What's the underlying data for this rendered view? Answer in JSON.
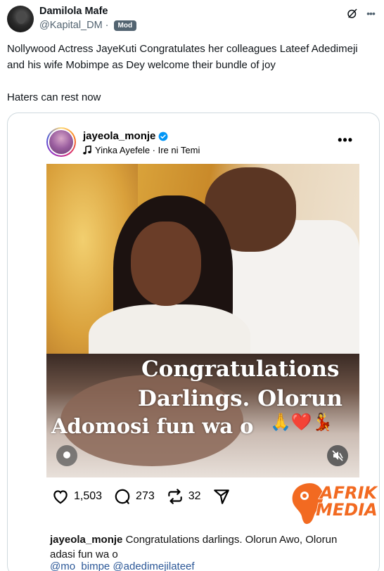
{
  "author": {
    "name": "Damilola Mafe",
    "handle": "@Kapital_DM",
    "separator": "·",
    "badge": "Mod"
  },
  "icons": {
    "grok": "grok-icon",
    "more": "more-icon"
  },
  "tweet": {
    "line1": "Nollywood Actress JayeKuti Congratulates her colleagues Lateef Adedimeji and his wife Mobimpe as Dey welcome their bundle of joy",
    "line2": "Haters can rest now"
  },
  "instagram": {
    "username": "jayeola_monje",
    "song": "Yinka Ayefele · Ire ni Temi",
    "more": "•••",
    "overlay": {
      "line1": "Congratulations",
      "line2": "Darlings. Olorun",
      "line3": "Adomosi fun wa o",
      "emojis": "🙏❤️💃"
    },
    "actions": {
      "likes": "1,503",
      "comments": "273",
      "reposts": "32"
    },
    "caption": {
      "user": "jayeola_monje",
      "text": "Congratulations darlings. Olorun Awo, Olorun adasi fun wa o"
    },
    "mentions": "@mo_bimpe @adedimejilateef"
  },
  "watermark": {
    "line1": "AFRIK",
    "line2": "MEDIA",
    "colors": {
      "orange": "#f26a21"
    }
  },
  "colors": {
    "text": "#0f1419",
    "secondary": "#536471",
    "border": "#cfd9de",
    "verified": "#0095f6",
    "mention": "#2b5797"
  }
}
